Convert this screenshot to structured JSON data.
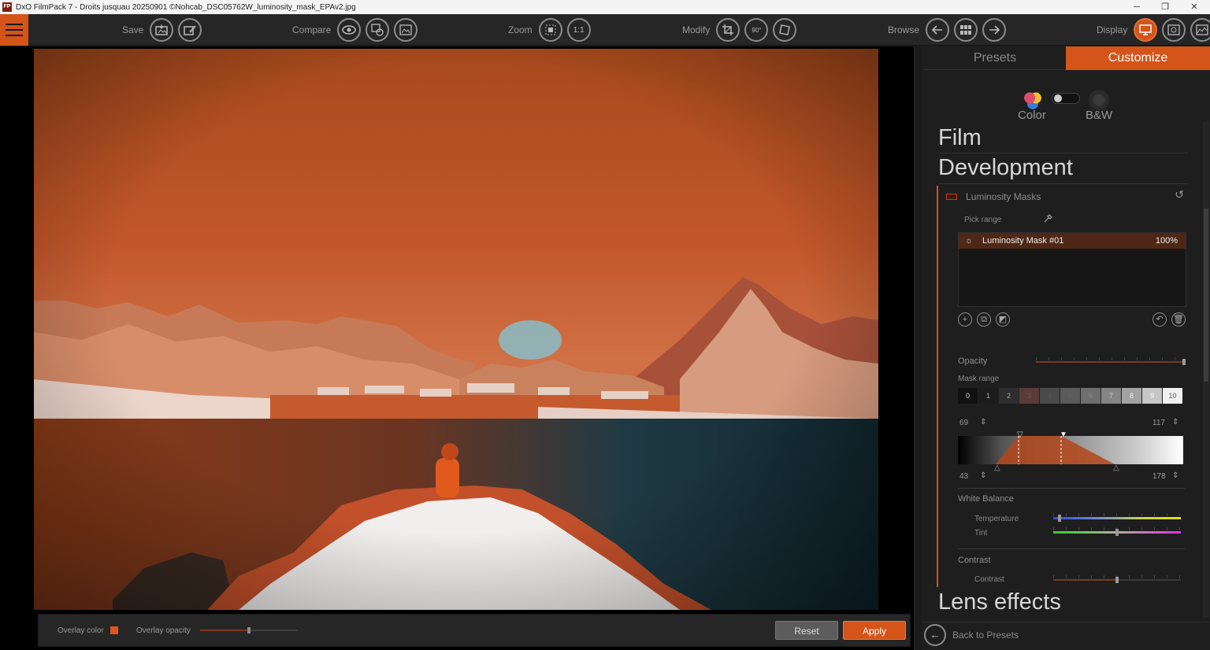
{
  "window": {
    "app_icon": "FP",
    "title": "DxO FilmPack 7 - Droits jusquau 20250901 ©Nohcab_DSC05762W_luminosity_mask_EPAv2.jpg",
    "minimize": "─",
    "restore": "❐",
    "close": "✕"
  },
  "toolbar": {
    "save_label": "Save",
    "compare_label": "Compare",
    "zoom_label": "Zoom",
    "zoom_one_to_one": "1:1",
    "modify_label": "Modify",
    "rotate_label": "90°",
    "browse_label": "Browse",
    "display_label": "Display"
  },
  "bottom_bar": {
    "overlay_color_label": "Overlay color",
    "overlay_opacity_label": "Overlay opacity",
    "overlay_opacity_value": 0.5,
    "reset_label": "Reset",
    "apply_label": "Apply",
    "overlay_color": "#e2551a"
  },
  "panel": {
    "tabs": {
      "presets": "Presets",
      "customize": "Customize"
    },
    "mode": {
      "color_label": "Color",
      "bw_label": "B&W"
    },
    "sections": {
      "film": "Film",
      "development": "Development",
      "lens_effects": "Lens effects"
    },
    "luminosity_masks": {
      "title": "Luminosity Masks",
      "pick_range_label": "Pick range",
      "masks": [
        {
          "name": "Luminosity Mask #01",
          "opacity": "100%"
        }
      ],
      "opacity_label": "Opacity",
      "opacity_value": 1.0,
      "mask_range_label": "Mask range",
      "zones": [
        "0",
        "1",
        "2",
        "3",
        "4",
        "5",
        "6",
        "7",
        "8",
        "9",
        "10"
      ],
      "inner_low": "69",
      "inner_high": "117",
      "outer_low": "43",
      "outer_high": "178"
    },
    "white_balance": {
      "title": "White Balance",
      "temperature_label": "Temperature",
      "temperature_value": 0.05,
      "tint_label": "Tint",
      "tint_value": 0.5
    },
    "contrast": {
      "title": "Contrast",
      "contrast_label": "Contrast",
      "contrast_value": 0.5
    },
    "back_label": "Back to Presets"
  },
  "colors": {
    "accent": "#d4541a",
    "panel_bg": "#1e1e1e",
    "toolbar_bg": "#262626"
  }
}
